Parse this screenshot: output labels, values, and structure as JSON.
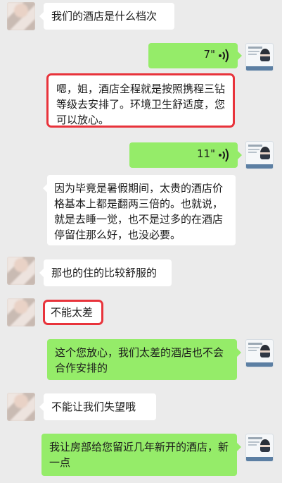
{
  "chat": {
    "messages": [
      {
        "side": "left",
        "type": "text",
        "text": "我们的酒店是什么档次"
      },
      {
        "side": "right",
        "type": "voice",
        "duration": "7\""
      },
      {
        "side": "left",
        "type": "text",
        "text": "嗯，姐，酒店全程就是按照携程三钻等级去安排了。环境卫生舒适度，您可以放心。",
        "highlighted": true
      },
      {
        "side": "right",
        "type": "voice",
        "duration": "11\""
      },
      {
        "side": "left",
        "type": "text",
        "text": "因为毕竟是暑假期间，太贵的酒店价格基本上都是翻两三倍的。也就说，就是去睡一觉，也不是过多的在酒店停留住那么好，也没必要。"
      },
      {
        "side": "left",
        "type": "text",
        "text": "那也的住的比较舒服的"
      },
      {
        "side": "left",
        "type": "text",
        "text": "不能太差",
        "highlighted": true
      },
      {
        "side": "right",
        "type": "text",
        "text": "这个您放心，我们太差的酒店也不会合作安排的"
      },
      {
        "side": "left",
        "type": "text",
        "text": "不能让我们失望哦"
      },
      {
        "side": "right",
        "type": "text",
        "text": "我让房部给您留近几年新开的酒店，新一点"
      }
    ]
  },
  "colors": {
    "background": "#ebebeb",
    "bubble_self": "#95ec69",
    "bubble_other": "#ffffff",
    "highlight": "#e8333b"
  },
  "icons": {
    "voice": "voice-wave-icon",
    "avatar_other": "blurred-avatar",
    "avatar_self": "business-card-avatar"
  }
}
